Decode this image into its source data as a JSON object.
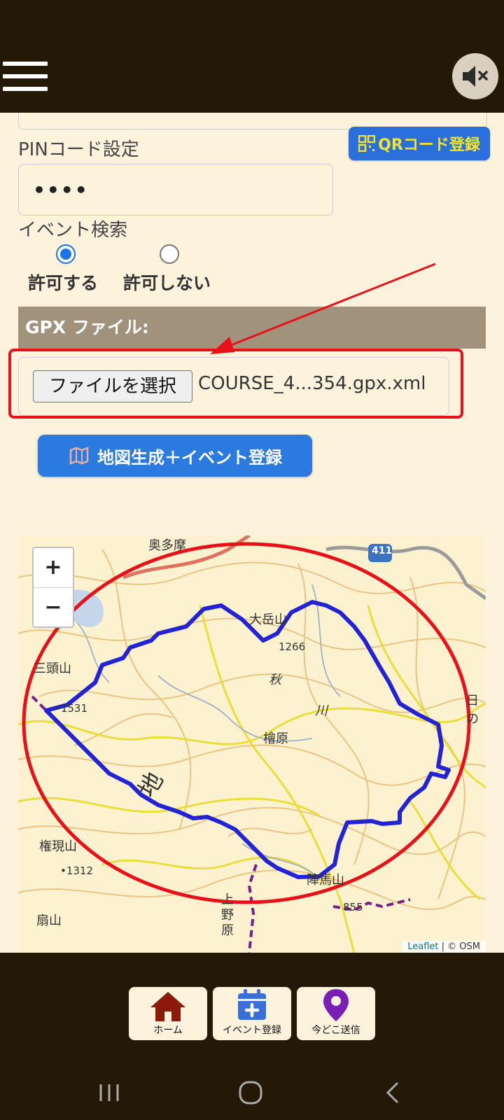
{
  "header": {
    "menu_icon": "hamburger-menu-icon",
    "mute_icon": "speaker-muted-icon"
  },
  "form": {
    "qr_button": "QRコード登録",
    "pin_label": "PINコード設定",
    "pin_value": "••••",
    "event_search_label": "イベント検索",
    "radio_allow": "許可する",
    "radio_deny": "許可しない",
    "radio_selected": "許可する",
    "gpx_header": "GPX ファイル:",
    "file_button": "ファイルを選択",
    "file_name": "COURSE_4...354.gpx.xml",
    "generate_button": "地図生成＋イベント登録"
  },
  "map": {
    "zoom_in": "+",
    "zoom_out": "−",
    "attribution_leaflet": "Leaflet",
    "attribution_rest": " | © OSM",
    "labels": {
      "okutama": "奥多摩",
      "odake": "大岳山",
      "elev1266": "1266",
      "mitou": "三頭山",
      "elev1531": "•1531",
      "aki": "秋",
      "kawa": "川",
      "hinohara": "檜原",
      "chi": "地",
      "gongen": "権現山",
      "elev1312": "•1312",
      "ougi": "扇山",
      "jinba": "陣馬山",
      "elev855": "855",
      "ueno": "上野原",
      "route": "411",
      "hi": "日の"
    }
  },
  "bottom_nav": {
    "home": "ホーム",
    "event_register": "イベント登録",
    "location_send": "今どこ送信"
  },
  "colors": {
    "header_bg": "#241806",
    "page_bg": "#fdf3dc",
    "accent_blue": "#2b6fdc",
    "annotation_red": "#e8111a",
    "route_blue": "#2323d6"
  }
}
